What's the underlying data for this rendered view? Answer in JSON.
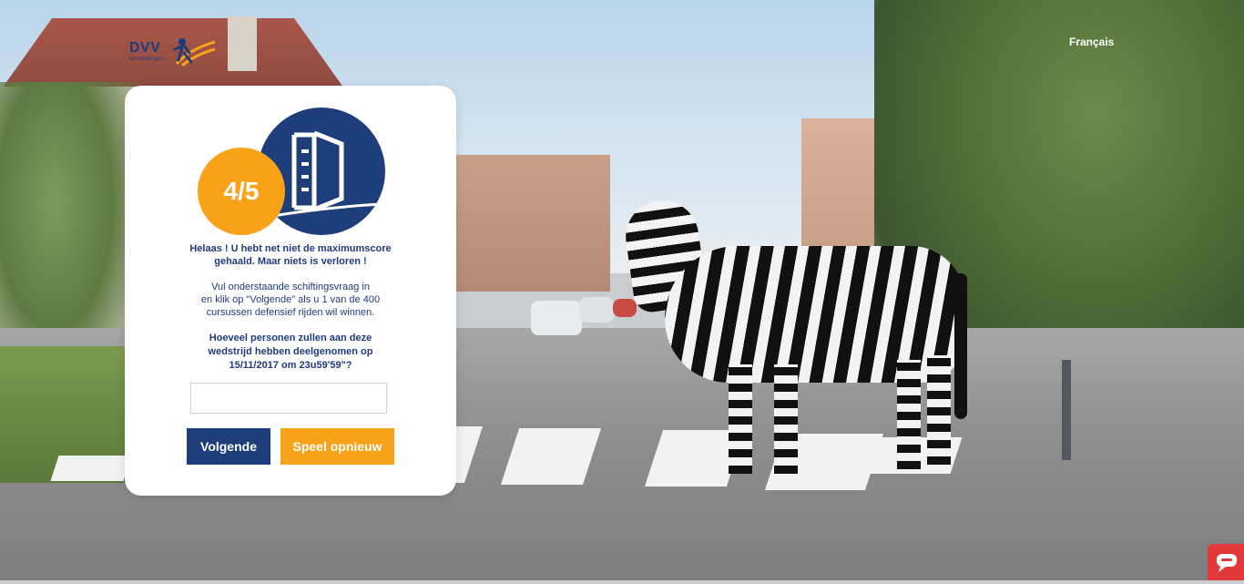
{
  "header": {
    "logo": {
      "brand": "DVV",
      "tagline": "verzekeringen"
    },
    "language_link": "Français"
  },
  "quiz": {
    "score": "4/5",
    "result_title_line1": "Helaas ! U hebt net niet de maximumscore",
    "result_title_line2": "gehaald. Maar niets is verloren !",
    "info_line1": "Vul onderstaande schiftingsvraag in",
    "info_line2": "en klik op \"Volgende\" als u 1 van de 400",
    "info_line3": "cursussen defensief rijden wil winnen.",
    "question_line1": "Hoeveel personen zullen aan deze",
    "question_line2": "wedstrijd hebben deelgenomen op",
    "question_line3": "15/11/2017 om 23u59'59\"?",
    "answer_value": "",
    "answer_placeholder": "",
    "next_button": "Volgende",
    "replay_button": "Speel opnieuw",
    "icon": "crosswalk-sign-icon"
  },
  "chat_widget": {
    "icon": "chat-bubble-icon"
  },
  "colors": {
    "brand_blue": "#1e3d7b",
    "brand_orange": "#f8a21a",
    "chat_red": "#e2393b"
  }
}
